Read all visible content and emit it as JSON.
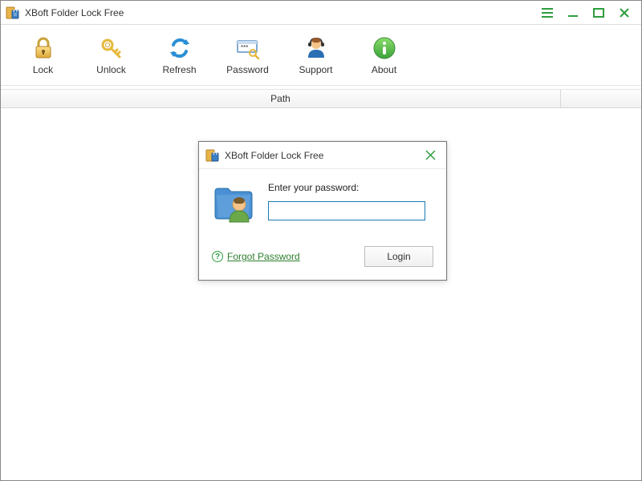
{
  "app": {
    "title": "XBoft Folder Lock Free"
  },
  "toolbar": {
    "lock": "Lock",
    "unlock": "Unlock",
    "refresh": "Refresh",
    "password": "Password",
    "support": "Support",
    "about": "About"
  },
  "table": {
    "path_header": "Path"
  },
  "modal": {
    "title": "XBoft Folder Lock Free",
    "prompt": "Enter your password:",
    "password_value": "",
    "forgot_label": "Forgot Password",
    "login_label": "Login"
  },
  "colors": {
    "accent": "#2e9e3f",
    "input_border": "#1b7ab3"
  }
}
